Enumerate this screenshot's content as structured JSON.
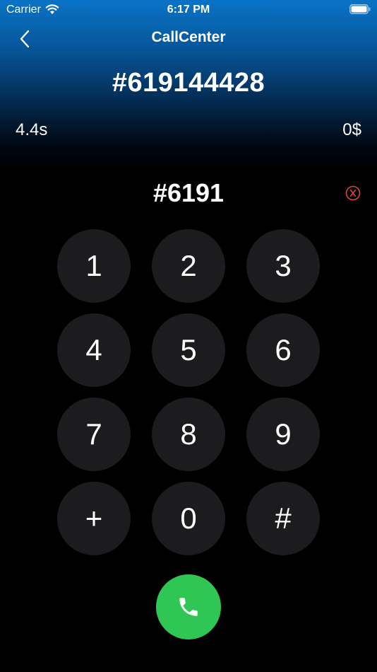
{
  "status_bar": {
    "carrier": "Carrier",
    "time": "6:17 PM"
  },
  "nav": {
    "title": "CallCenter"
  },
  "call": {
    "number": "#619144428",
    "duration": "4.4s",
    "cost": "0$"
  },
  "dialer": {
    "input": "#6191",
    "keys": [
      "1",
      "2",
      "3",
      "4",
      "5",
      "6",
      "7",
      "8",
      "9",
      "+",
      "0",
      "#"
    ]
  },
  "colors": {
    "accent_blue": "#0a73c6",
    "call_green": "#2fc654",
    "clear_red": "#e0453a",
    "key_bg": "#1c1c1e"
  }
}
